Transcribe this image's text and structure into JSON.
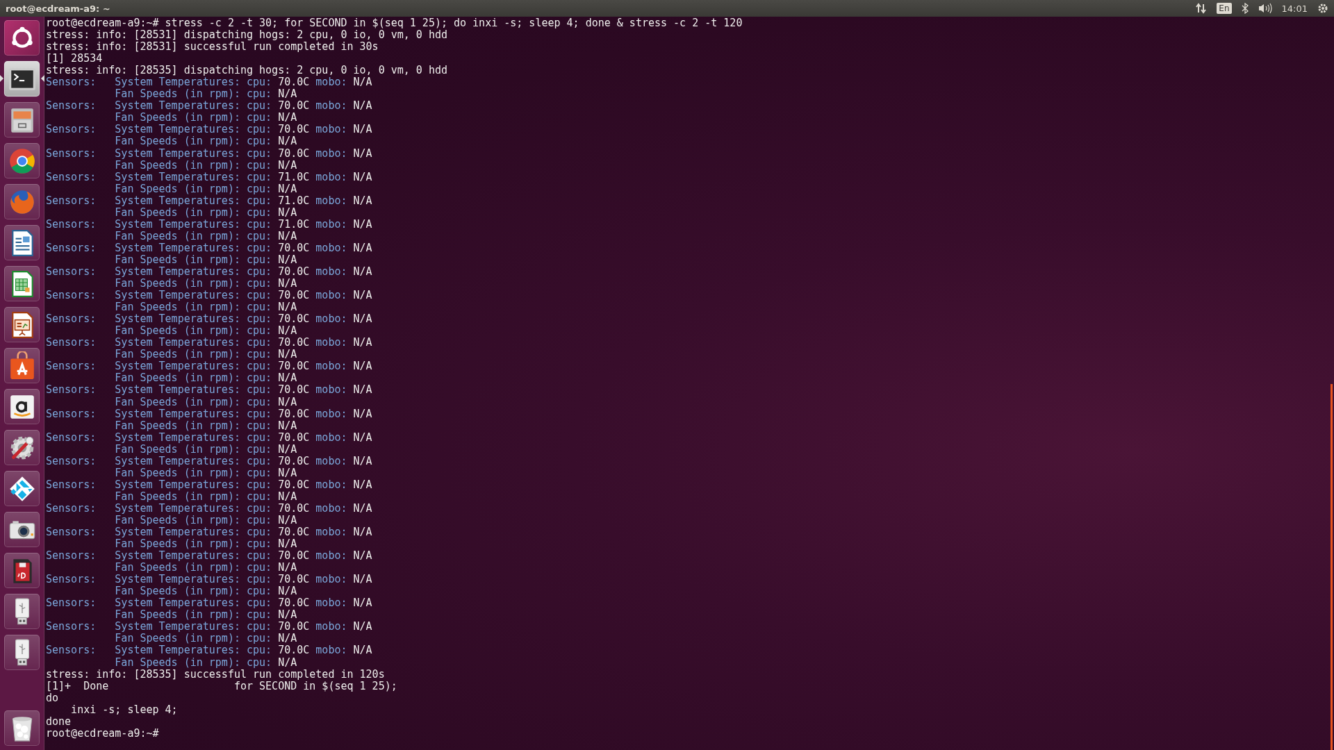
{
  "top_bar": {
    "title": "root@ecdream-a9: ~",
    "keyboard": "En",
    "clock": "14:01"
  },
  "launcher": {
    "items": [
      {
        "kind": "ubuntu",
        "active": false
      },
      {
        "kind": "terminal",
        "active": true
      },
      {
        "kind": "files",
        "active": false
      },
      {
        "kind": "chrome",
        "active": false
      },
      {
        "kind": "firefox",
        "active": false
      },
      {
        "kind": "writer",
        "active": false
      },
      {
        "kind": "calc",
        "active": false
      },
      {
        "kind": "impress",
        "active": false
      },
      {
        "kind": "software",
        "active": false
      },
      {
        "kind": "amazon",
        "active": false
      },
      {
        "kind": "settings",
        "active": false
      },
      {
        "kind": "kodi",
        "active": false
      },
      {
        "kind": "camera",
        "active": false
      },
      {
        "kind": "sdcard",
        "active": false
      },
      {
        "kind": "usb",
        "active": false
      },
      {
        "kind": "usb",
        "active": false
      }
    ],
    "trash": {
      "kind": "trash",
      "active": false
    }
  },
  "terminal": {
    "header": [
      "root@ecdream-a9:~# stress -c 2 -t 30; for SECOND in $(seq 1 25); do inxi -s; sleep 4; done & stress -c 2 -t 120",
      "stress: info: [28531] dispatching hogs: 2 cpu, 0 io, 0 vm, 0 hdd",
      "stress: info: [28531] successful run completed in 30s",
      "[1] 28534",
      "stress: info: [28535] dispatching hogs: 2 cpu, 0 io, 0 vm, 0 hdd"
    ],
    "sensors": [
      {
        "label": "Sensors:",
        "temps_label": "System Temperatures: cpu:",
        "cpu": "70.0C",
        "mobo_label": "mobo:",
        "mobo": "N/A",
        "fans_label": "Fan Speeds (in rpm): cpu:",
        "fan_cpu": "N/A"
      },
      {
        "label": "Sensors:",
        "temps_label": "System Temperatures: cpu:",
        "cpu": "70.0C",
        "mobo_label": "mobo:",
        "mobo": "N/A",
        "fans_label": "Fan Speeds (in rpm): cpu:",
        "fan_cpu": "N/A"
      },
      {
        "label": "Sensors:",
        "temps_label": "System Temperatures: cpu:",
        "cpu": "70.0C",
        "mobo_label": "mobo:",
        "mobo": "N/A",
        "fans_label": "Fan Speeds (in rpm): cpu:",
        "fan_cpu": "N/A"
      },
      {
        "label": "Sensors:",
        "temps_label": "System Temperatures: cpu:",
        "cpu": "70.0C",
        "mobo_label": "mobo:",
        "mobo": "N/A",
        "fans_label": "Fan Speeds (in rpm): cpu:",
        "fan_cpu": "N/A"
      },
      {
        "label": "Sensors:",
        "temps_label": "System Temperatures: cpu:",
        "cpu": "71.0C",
        "mobo_label": "mobo:",
        "mobo": "N/A",
        "fans_label": "Fan Speeds (in rpm): cpu:",
        "fan_cpu": "N/A"
      },
      {
        "label": "Sensors:",
        "temps_label": "System Temperatures: cpu:",
        "cpu": "71.0C",
        "mobo_label": "mobo:",
        "mobo": "N/A",
        "fans_label": "Fan Speeds (in rpm): cpu:",
        "fan_cpu": "N/A"
      },
      {
        "label": "Sensors:",
        "temps_label": "System Temperatures: cpu:",
        "cpu": "71.0C",
        "mobo_label": "mobo:",
        "mobo": "N/A",
        "fans_label": "Fan Speeds (in rpm): cpu:",
        "fan_cpu": "N/A"
      },
      {
        "label": "Sensors:",
        "temps_label": "System Temperatures: cpu:",
        "cpu": "70.0C",
        "mobo_label": "mobo:",
        "mobo": "N/A",
        "fans_label": "Fan Speeds (in rpm): cpu:",
        "fan_cpu": "N/A"
      },
      {
        "label": "Sensors:",
        "temps_label": "System Temperatures: cpu:",
        "cpu": "70.0C",
        "mobo_label": "mobo:",
        "mobo": "N/A",
        "fans_label": "Fan Speeds (in rpm): cpu:",
        "fan_cpu": "N/A"
      },
      {
        "label": "Sensors:",
        "temps_label": "System Temperatures: cpu:",
        "cpu": "70.0C",
        "mobo_label": "mobo:",
        "mobo": "N/A",
        "fans_label": "Fan Speeds (in rpm): cpu:",
        "fan_cpu": "N/A"
      },
      {
        "label": "Sensors:",
        "temps_label": "System Temperatures: cpu:",
        "cpu": "70.0C",
        "mobo_label": "mobo:",
        "mobo": "N/A",
        "fans_label": "Fan Speeds (in rpm): cpu:",
        "fan_cpu": "N/A"
      },
      {
        "label": "Sensors:",
        "temps_label": "System Temperatures: cpu:",
        "cpu": "70.0C",
        "mobo_label": "mobo:",
        "mobo": "N/A",
        "fans_label": "Fan Speeds (in rpm): cpu:",
        "fan_cpu": "N/A"
      },
      {
        "label": "Sensors:",
        "temps_label": "System Temperatures: cpu:",
        "cpu": "70.0C",
        "mobo_label": "mobo:",
        "mobo": "N/A",
        "fans_label": "Fan Speeds (in rpm): cpu:",
        "fan_cpu": "N/A"
      },
      {
        "label": "Sensors:",
        "temps_label": "System Temperatures: cpu:",
        "cpu": "70.0C",
        "mobo_label": "mobo:",
        "mobo": "N/A",
        "fans_label": "Fan Speeds (in rpm): cpu:",
        "fan_cpu": "N/A"
      },
      {
        "label": "Sensors:",
        "temps_label": "System Temperatures: cpu:",
        "cpu": "70.0C",
        "mobo_label": "mobo:",
        "mobo": "N/A",
        "fans_label": "Fan Speeds (in rpm): cpu:",
        "fan_cpu": "N/A"
      },
      {
        "label": "Sensors:",
        "temps_label": "System Temperatures: cpu:",
        "cpu": "70.0C",
        "mobo_label": "mobo:",
        "mobo": "N/A",
        "fans_label": "Fan Speeds (in rpm): cpu:",
        "fan_cpu": "N/A"
      },
      {
        "label": "Sensors:",
        "temps_label": "System Temperatures: cpu:",
        "cpu": "70.0C",
        "mobo_label": "mobo:",
        "mobo": "N/A",
        "fans_label": "Fan Speeds (in rpm): cpu:",
        "fan_cpu": "N/A"
      },
      {
        "label": "Sensors:",
        "temps_label": "System Temperatures: cpu:",
        "cpu": "70.0C",
        "mobo_label": "mobo:",
        "mobo": "N/A",
        "fans_label": "Fan Speeds (in rpm): cpu:",
        "fan_cpu": "N/A"
      },
      {
        "label": "Sensors:",
        "temps_label": "System Temperatures: cpu:",
        "cpu": "70.0C",
        "mobo_label": "mobo:",
        "mobo": "N/A",
        "fans_label": "Fan Speeds (in rpm): cpu:",
        "fan_cpu": "N/A"
      },
      {
        "label": "Sensors:",
        "temps_label": "System Temperatures: cpu:",
        "cpu": "70.0C",
        "mobo_label": "mobo:",
        "mobo": "N/A",
        "fans_label": "Fan Speeds (in rpm): cpu:",
        "fan_cpu": "N/A"
      },
      {
        "label": "Sensors:",
        "temps_label": "System Temperatures: cpu:",
        "cpu": "70.0C",
        "mobo_label": "mobo:",
        "mobo": "N/A",
        "fans_label": "Fan Speeds (in rpm): cpu:",
        "fan_cpu": "N/A"
      },
      {
        "label": "Sensors:",
        "temps_label": "System Temperatures: cpu:",
        "cpu": "70.0C",
        "mobo_label": "mobo:",
        "mobo": "N/A",
        "fans_label": "Fan Speeds (in rpm): cpu:",
        "fan_cpu": "N/A"
      },
      {
        "label": "Sensors:",
        "temps_label": "System Temperatures: cpu:",
        "cpu": "70.0C",
        "mobo_label": "mobo:",
        "mobo": "N/A",
        "fans_label": "Fan Speeds (in rpm): cpu:",
        "fan_cpu": "N/A"
      },
      {
        "label": "Sensors:",
        "temps_label": "System Temperatures: cpu:",
        "cpu": "70.0C",
        "mobo_label": "mobo:",
        "mobo": "N/A",
        "fans_label": "Fan Speeds (in rpm): cpu:",
        "fan_cpu": "N/A"
      },
      {
        "label": "Sensors:",
        "temps_label": "System Temperatures: cpu:",
        "cpu": "70.0C",
        "mobo_label": "mobo:",
        "mobo": "N/A",
        "fans_label": "Fan Speeds (in rpm): cpu:",
        "fan_cpu": "N/A"
      }
    ],
    "completed": "stress: info: [28535] successful run completed in 120s",
    "job": {
      "status": "[1]+  Done",
      "command": "for SECOND in $(seq 1 25);"
    },
    "body": [
      {
        "kind": "plain",
        "text": "do"
      },
      {
        "kind": "indent",
        "text": "inxi -s; sleep 4;"
      },
      {
        "kind": "plain",
        "text": "done"
      }
    ],
    "prompt": "root@ecdream-a9:~#"
  }
}
